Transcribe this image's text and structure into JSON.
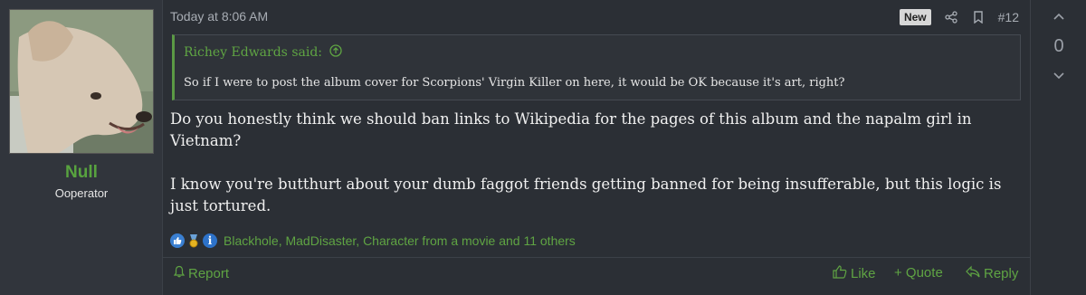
{
  "user": {
    "name": "Null",
    "title": "Ooperator",
    "avatar_icon": "dog-avatar-icon"
  },
  "post": {
    "date": "Today at 8:06 AM",
    "badge": "New",
    "number": "#12",
    "icons": [
      "share-icon",
      "bookmark-icon"
    ]
  },
  "quote": {
    "author": "Richey Edwards said:",
    "text": "So if I were to post the album cover for Scorpions' Virgin Killer on here, it would be OK because it's art, right?"
  },
  "body": {
    "p1": "Do you honestly think we should ban links to Wikipedia for the pages of this album and the napalm girl in Vietnam?",
    "p2": "I know you're butthurt about your dumb faggot friends getting banned for being insufferable, but this logic is just tortured."
  },
  "reactions": {
    "text": "Blackhole, MadDisaster, Character from a movie and 11 others",
    "icons": [
      "like-reaction-icon",
      "winner-reaction-icon",
      "informative-reaction-icon"
    ]
  },
  "footer": {
    "report": "Report",
    "like": "Like",
    "quote": "+ Quote",
    "reply": "Reply"
  },
  "vote": {
    "count": "0"
  },
  "colors": {
    "accent_green": "#5fa443",
    "background": "#2b2f35",
    "badge_bg": "#d7d7d7"
  }
}
